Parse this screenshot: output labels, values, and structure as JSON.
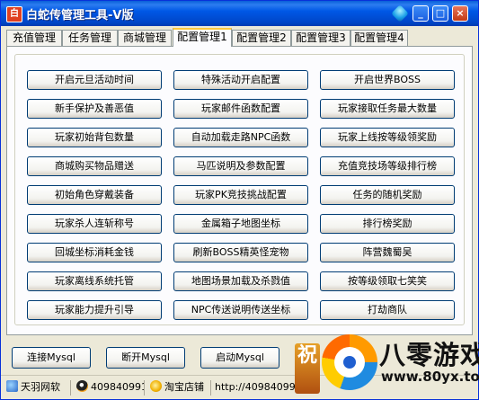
{
  "window": {
    "title": "白蛇传管理工具-V版",
    "app_icon": "白"
  },
  "tabs": [
    {
      "label": "充值管理"
    },
    {
      "label": "任务管理"
    },
    {
      "label": "商城管理"
    },
    {
      "label": "配置管理1"
    },
    {
      "label": "配置管理2"
    },
    {
      "label": "配置管理3"
    },
    {
      "label": "配置管理4"
    }
  ],
  "active_tab": "配置管理1",
  "buttons": [
    [
      "开启元旦活动时间",
      "特殊活动开启配置",
      "开启世界BOSS"
    ],
    [
      "新手保护及善恶值",
      "玩家邮件函数配置",
      "玩家接取任务最大数量"
    ],
    [
      "玩家初始背包数量",
      "自动加载走路NPC函数",
      "玩家上线按等级领奖励"
    ],
    [
      "商城购买物品赠送",
      "马匹说明及参数配置",
      "充值竞技场等级排行榜"
    ],
    [
      "初始角色穿戴装备",
      "玩家PK竞技挑战配置",
      "任务的随机奖励"
    ],
    [
      "玩家杀人连斩称号",
      "金属箱子地图坐标",
      "排行榜奖励"
    ],
    [
      "回城坐标消耗金钱",
      "刷新BOSS精英怪宠物",
      "阵营魏蜀吴"
    ],
    [
      "玩家离线系统托管",
      "地图场景加载及杀戮值",
      "按等级领取七笑笑"
    ],
    [
      "玩家能力提升引导",
      "NPC传送说明传送坐标",
      "打劫商队"
    ]
  ],
  "bottom_buttons": [
    "连接Mysql",
    "断开Mysql",
    "启动Mysql"
  ],
  "statusbar": {
    "company": "天羽网软",
    "qq": "409840991",
    "shop": "淘宝店铺",
    "url": "http://40984099"
  },
  "watermark": {
    "side": "祝",
    "brand": "八零游戏",
    "url": "www.80yx.top"
  },
  "colors": {
    "titlebar": "#0058e6",
    "tab_active_highlight": "#ffc83c",
    "button_border": "#003c74"
  }
}
